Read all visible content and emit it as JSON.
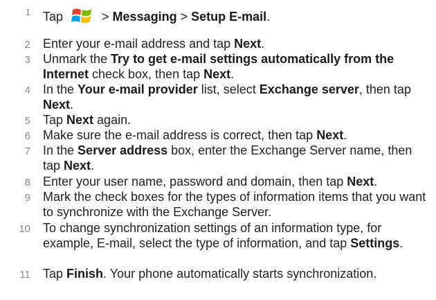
{
  "steps": [
    {
      "num": "1",
      "parts": [
        {
          "t": "Tap "
        },
        {
          "icon": "windows-start-icon"
        },
        {
          "t": " > "
        },
        {
          "b": "Messaging"
        },
        {
          "t": " > "
        },
        {
          "b": "Setup E-mail"
        },
        {
          "t": "."
        }
      ]
    },
    {
      "num": "2",
      "parts": [
        {
          "t": "Enter your e-mail address and tap "
        },
        {
          "b": "Next"
        },
        {
          "t": "."
        }
      ]
    },
    {
      "num": "3",
      "parts": [
        {
          "t": "Unmark the "
        },
        {
          "b": "Try to get e-mail settings automatically from the Internet"
        },
        {
          "t": " check box, then tap "
        },
        {
          "b": "Next"
        },
        {
          "t": "."
        }
      ]
    },
    {
      "num": "4",
      "parts": [
        {
          "t": "In the "
        },
        {
          "b": "Your e-mail provider"
        },
        {
          "t": " list, select "
        },
        {
          "b": "Exchange server"
        },
        {
          "t": ", then tap "
        },
        {
          "b": "Next"
        },
        {
          "t": "."
        }
      ]
    },
    {
      "num": "5",
      "parts": [
        {
          "t": "Tap "
        },
        {
          "b": "Next"
        },
        {
          "t": " again."
        }
      ]
    },
    {
      "num": "6",
      "parts": [
        {
          "t": "Make sure the e-mail address is correct, then tap "
        },
        {
          "b": "Next"
        },
        {
          "t": "."
        }
      ]
    },
    {
      "num": "7",
      "parts": [
        {
          "t": "In the "
        },
        {
          "b": "Server address"
        },
        {
          "t": " box, enter the Exchange Server name, then tap "
        },
        {
          "b": "Next"
        },
        {
          "t": "."
        }
      ]
    },
    {
      "num": "8",
      "parts": [
        {
          "t": "Enter your user name, password and domain, then tap "
        },
        {
          "b": "Next"
        },
        {
          "t": "."
        }
      ]
    },
    {
      "num": "9",
      "parts": [
        {
          "t": "Mark the check boxes for the types of information items that you want to synchronize with the Exchange Server."
        }
      ]
    },
    {
      "num": "10",
      "parts": [
        {
          "t": "To change synchronization settings of an information type, for example, E-mail, select the type of information, and tap "
        },
        {
          "b": "Settings"
        },
        {
          "t": "."
        }
      ]
    },
    {
      "num": "11",
      "parts": [
        {
          "t": "Tap "
        },
        {
          "b": "Finish"
        },
        {
          "t": ". Your phone automatically starts synchronization."
        }
      ]
    }
  ]
}
